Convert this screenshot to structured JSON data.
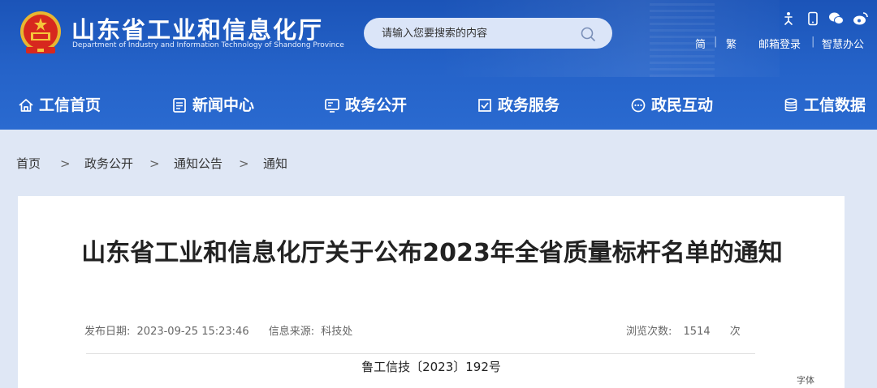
{
  "header": {
    "title": "山东省工业和信息化厅",
    "subtitle": "Department of Industry and Information Technology of Shandong Province",
    "search_placeholder": "请输入您要搜索的内容",
    "links": {
      "simplified": "简",
      "separator": "|",
      "traditional": "繁",
      "mail_login": "邮箱登录",
      "smart_office": "智慧办公"
    },
    "icons": [
      "accessibility-icon",
      "mobile-icon",
      "wechat-icon",
      "weibo-icon"
    ]
  },
  "nav": {
    "items": [
      {
        "label": "工信首页",
        "icon": "home-icon"
      },
      {
        "label": "新闻中心",
        "icon": "news-icon"
      },
      {
        "label": "政务公开",
        "icon": "gov-open-icon"
      },
      {
        "label": "政务服务",
        "icon": "gov-service-icon"
      },
      {
        "label": "政民互动",
        "icon": "interaction-icon"
      },
      {
        "label": "工信数据",
        "icon": "database-icon"
      }
    ]
  },
  "breadcrumb": {
    "items": [
      "首页",
      "政务公开",
      "通知公告",
      "通知"
    ],
    "separator": ">"
  },
  "article": {
    "title": "山东省工业和信息化厅关于公布2023年全省质量标杆名单的通知",
    "publish_label": "发布日期:",
    "publish_date": "2023-09-25 15:23:46",
    "source_label": "信息来源:",
    "source": "科技处",
    "views_label": "浏览次数:",
    "views": "1514",
    "views_unit": "次",
    "doc_number": "鲁工信技〔2023〕192号",
    "font_size_label": "字体"
  },
  "colors": {
    "header_blue": "#2563c9",
    "page_bg": "#dfe7f5"
  }
}
